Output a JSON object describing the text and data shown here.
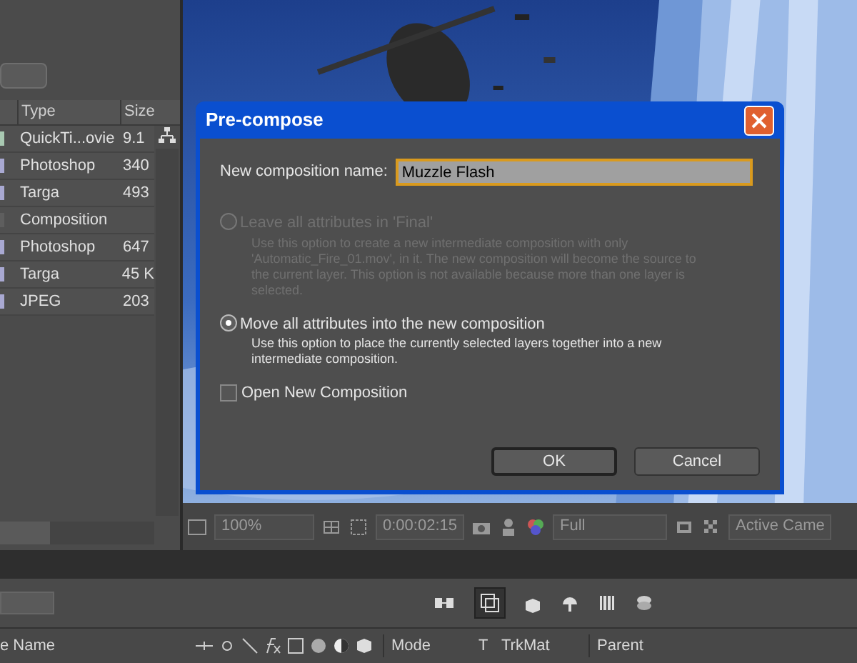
{
  "project": {
    "columns": [
      "Type",
      "Size"
    ],
    "rows": [
      {
        "type": "QuickTi...ovie",
        "size": "9.1",
        "color": "#a9c9b2"
      },
      {
        "type": "Photoshop",
        "size": "340",
        "color": "#a9a9d2"
      },
      {
        "type": "Targa",
        "size": "493",
        "color": "#a9a9d2"
      },
      {
        "type": "Composition",
        "size": "",
        "color": "#5e5e5e"
      },
      {
        "type": "Photoshop",
        "size": "647",
        "color": "#a9a9d2"
      },
      {
        "type": "Targa",
        "size": "45 K",
        "color": "#a9a9d2"
      },
      {
        "type": "JPEG",
        "size": "203",
        "color": "#a9a9d2"
      }
    ]
  },
  "viewer": {
    "kind": "picture",
    "zoom": "100%",
    "timecode": "0:00:02:15",
    "resolution": "Full",
    "view": "Active Came"
  },
  "dialog": {
    "title": "Pre-compose",
    "name_label": "New composition name:",
    "name_value": "Muzzle Flash",
    "options": [
      {
        "label": "Leave all attributes in 'Final'",
        "description": "Use this option to create a new intermediate composition with only 'Automatic_Fire_01.mov', in it. The new composition will become the source to the current layer. This option is not available because more than one layer is selected.",
        "selected": false,
        "disabled": true
      },
      {
        "label": "Move all attributes into the new composition",
        "description": "Use this option to place the currently selected layers together into a new intermediate composition.",
        "selected": true,
        "disabled": false
      }
    ],
    "open_new": {
      "label": "Open New Composition",
      "checked": false
    },
    "buttons": [
      "OK",
      "Cancel"
    ]
  },
  "timeline": {
    "columns": [
      "e Name",
      "Mode",
      "T",
      "TrkMat",
      "Parent"
    ]
  }
}
